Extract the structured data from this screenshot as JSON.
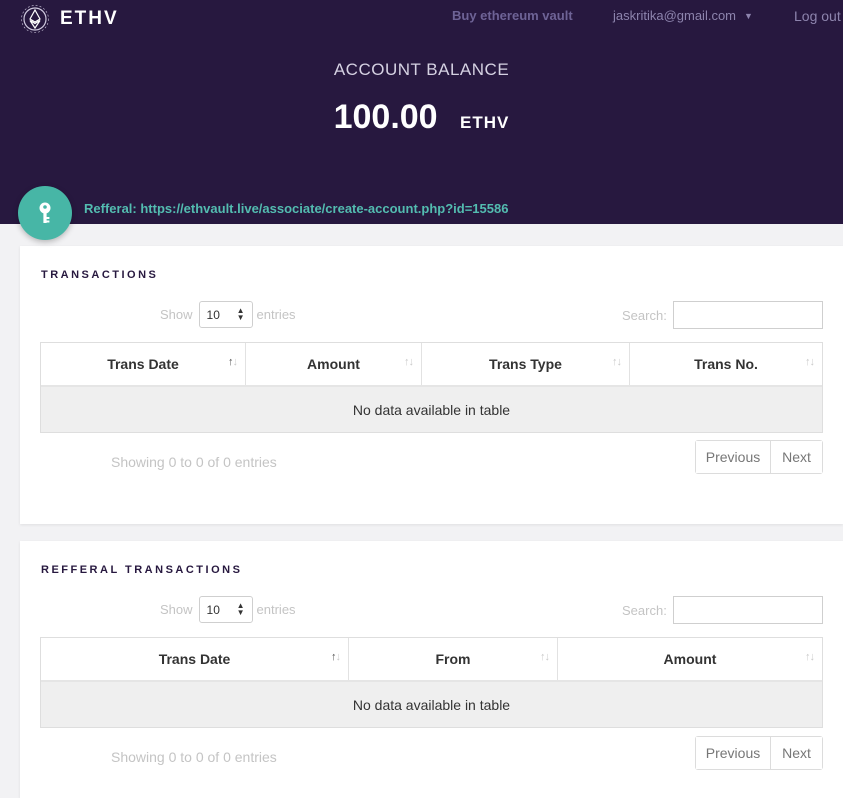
{
  "header": {
    "brand": "ETHV",
    "nav": {
      "buy": "Buy ethereum vault",
      "user_email": "jaskritika@gmail.com",
      "logout": "Log out"
    },
    "balance_label": "ACCOUNT BALANCE",
    "balance_amount": "100.00",
    "balance_unit": "ETHV",
    "referral_text": "Refferal: https://ethvault.live/associate/create-account.php?id=15586"
  },
  "colors": {
    "header_bg": "#27183f",
    "accent_teal": "#47b6a6",
    "referral_text": "#53bcb0"
  },
  "icons": {
    "logo": "ethereum-logo-icon",
    "user_dropdown": "caret-down-icon",
    "referral": "key-icon",
    "sort": "sort-arrows-icon"
  },
  "transactions": {
    "title": "TRANSACTIONS",
    "show_label": "Show",
    "entries_value": "10",
    "entries_label": "entries",
    "search_label": "Search:",
    "search_value": "",
    "columns": [
      "Trans Date",
      "Amount",
      "Trans Type",
      "Trans No."
    ],
    "empty_message": "No data available in table",
    "info": "Showing 0 to 0 of 0 entries",
    "prev_label": "Previous",
    "next_label": "Next"
  },
  "referral_transactions": {
    "title": "REFFERAL TRANSACTIONS",
    "show_label": "Show",
    "entries_value": "10",
    "entries_label": "entries",
    "search_label": "Search:",
    "search_value": "",
    "columns": [
      "Trans Date",
      "From",
      "Amount"
    ],
    "empty_message": "No data available in table",
    "info": "Showing 0 to 0 of 0 entries",
    "prev_label": "Previous",
    "next_label": "Next"
  }
}
